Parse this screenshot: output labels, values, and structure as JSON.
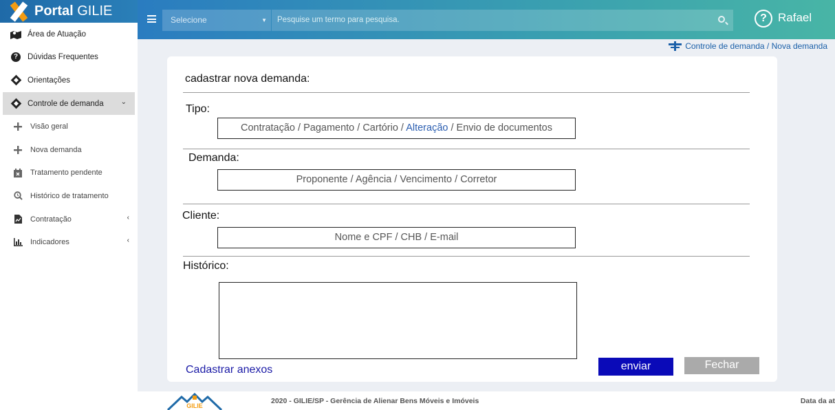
{
  "brand": {
    "title_bold": "Portal",
    "title_rest": " GILIE"
  },
  "sidebar": {
    "items": [
      {
        "label": "Área de Atuação",
        "icon": "map-marker-icon"
      },
      {
        "label": "Dúvidas Frequentes",
        "icon": "question-circle-icon"
      },
      {
        "label": "Orientações",
        "icon": "directions-icon"
      },
      {
        "label": "Controle de demanda",
        "icon": "directions-icon",
        "expanded": true
      },
      {
        "label": "Visão geral",
        "icon": "plus-icon"
      },
      {
        "label": "Nova demanda",
        "icon": "plus-icon"
      },
      {
        "label": "Tratamento pendente",
        "icon": "calendar-x-icon"
      },
      {
        "label": "Histórico de tratamento",
        "icon": "search-history-icon"
      },
      {
        "label": "Contratação",
        "icon": "document-chart-icon"
      },
      {
        "label": "Indicadores",
        "icon": "bar-chart-icon"
      }
    ]
  },
  "topbar": {
    "select_value": "Selecione",
    "search_placeholder": "Pesquise um termo para pesquisa.",
    "help_symbol": "?",
    "user_name": "Rafael"
  },
  "breadcrumb": {
    "text": "Controle de demanda / Nova demanda"
  },
  "form": {
    "title": "cadastrar nova demanda:",
    "tipo": {
      "label": "Tipo:",
      "options_before": "Contratação / Pagamento / Cartório / ",
      "option_highlighted": "Alteração",
      "options_after": " / Envio de documentos"
    },
    "demanda": {
      "label": "Demanda:",
      "value": "Proponente / Agência / Vencimento / Corretor"
    },
    "cliente": {
      "label": "Cliente:",
      "value": "Nome e CPF / CHB / E-mail"
    },
    "historico": {
      "label": "Histórico:",
      "value": ""
    },
    "attach_link": "Cadastrar anexos",
    "send_button": "enviar",
    "close_button": "Fechar"
  },
  "footer": {
    "logo_text": "GILIE",
    "text": "2020 - GILIE/SP - Gerência de Alienar Bens Móveis e Imóveis",
    "date_label": "Data da at"
  },
  "colors": {
    "accent": "#2a7cc0",
    "highlight": "#2a5db0",
    "send_button": "#0a0ab8",
    "close_button": "#aaaaaa"
  }
}
